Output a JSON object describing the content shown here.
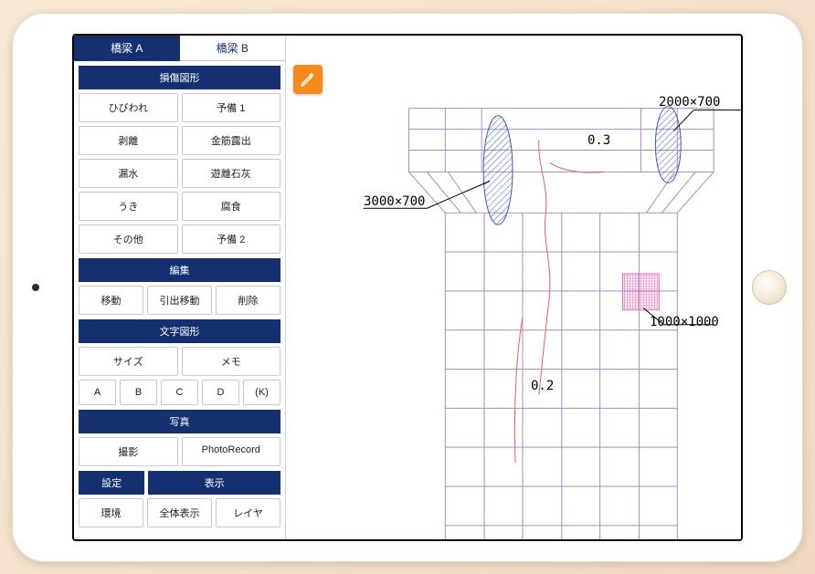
{
  "tabs": {
    "a": "橋梁 A",
    "b": "橋梁 B"
  },
  "sections": {
    "damage": "損傷図形",
    "edit": "編集",
    "text": "文字図形",
    "photo": "写真",
    "settings": "設定",
    "display": "表示"
  },
  "damage_buttons": {
    "crack": "ひびわれ",
    "reserve1": "予備 1",
    "peel": "剥離",
    "rebar": "金筋露出",
    "leak": "漏水",
    "lime": "遊離石灰",
    "float": "うき",
    "corrosion": "腐食",
    "other": "その他",
    "reserve2": "予備 2"
  },
  "edit_buttons": {
    "move": "移動",
    "leader_move": "引出移動",
    "delete": "削除"
  },
  "text_buttons": {
    "size": "サイズ",
    "memo": "メモ",
    "a": "A",
    "b": "B",
    "c": "C",
    "d": "D",
    "k": "(K)"
  },
  "photo_buttons": {
    "capture": "撮影",
    "record": "PhotoRecord"
  },
  "bottom_buttons": {
    "env": "環境",
    "fit": "全体表示",
    "layer": "レイヤ"
  },
  "annotations": {
    "dim1": "2000×700",
    "dim2": "3000×700",
    "dim3": "1000×1000",
    "val1": "0.3",
    "val2": "0.2"
  }
}
